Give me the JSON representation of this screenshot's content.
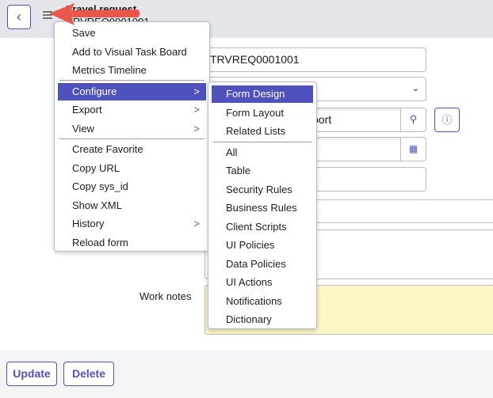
{
  "header": {
    "title": "Travel request",
    "subtitle": "TRVREQ0001001"
  },
  "form": {
    "number_value": "TRVREQ0001001",
    "reference_value_partial": "port",
    "work_notes_label": "Work notes"
  },
  "context_menu": {
    "items": [
      {
        "label": "Save"
      },
      {
        "label": "Add to Visual Task Board"
      },
      {
        "label": "Metrics Timeline"
      },
      {
        "label": "Configure",
        "submenu": true,
        "active": true
      },
      {
        "label": "Export",
        "submenu": true
      },
      {
        "label": "View",
        "submenu": true
      },
      {
        "label": "Create Favorite"
      },
      {
        "label": "Copy URL"
      },
      {
        "label": "Copy sys_id"
      },
      {
        "label": "Show XML"
      },
      {
        "label": "History",
        "submenu": true
      },
      {
        "label": "Reload form"
      }
    ]
  },
  "configure_submenu": {
    "items": [
      "Form Design",
      "Form Layout",
      "Related Lists",
      "All",
      "Table",
      "Security Rules",
      "Business Rules",
      "Client Scripts",
      "UI Policies",
      "Data Policies",
      "UI Actions",
      "Notifications",
      "Dictionary"
    ]
  },
  "footer": {
    "update_label": "Update",
    "delete_label": "Delete"
  },
  "colors": {
    "accent": "#4f52bd",
    "arrow": "#e8574a",
    "work_notes_bg": "#fbf6c4"
  }
}
